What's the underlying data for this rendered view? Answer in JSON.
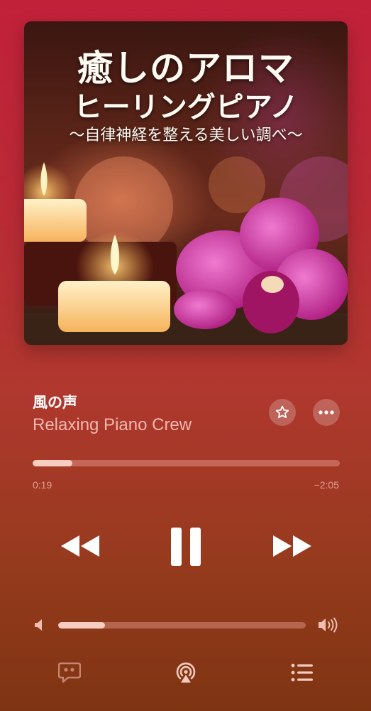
{
  "album": {
    "title_line1": "癒しのアロマ",
    "title_line2": "ヒーリングピアノ",
    "subtitle": "〜自律神経を整える美しい調べ〜"
  },
  "track": {
    "title": "風の声",
    "artist": "Relaxing Piano Crew"
  },
  "playback": {
    "elapsed": "0:19",
    "remaining": "−2:05",
    "progress_fraction": 0.13,
    "state": "playing"
  },
  "volume": {
    "level_fraction": 0.19
  },
  "icons": {
    "favorite": "star-icon",
    "more": "ellipsis-icon",
    "rewind": "rewind-icon",
    "pause": "pause-icon",
    "forward": "fast-forward-icon",
    "volume_low": "speaker-low-icon",
    "volume_high": "speaker-high-icon",
    "lyrics": "lyrics-quote-icon",
    "airplay": "airplay-icon",
    "queue": "queue-list-icon"
  },
  "colors": {
    "background_top": "#c2213a",
    "background_bottom": "#7e3412",
    "accent_text": "#ffcdc8"
  }
}
